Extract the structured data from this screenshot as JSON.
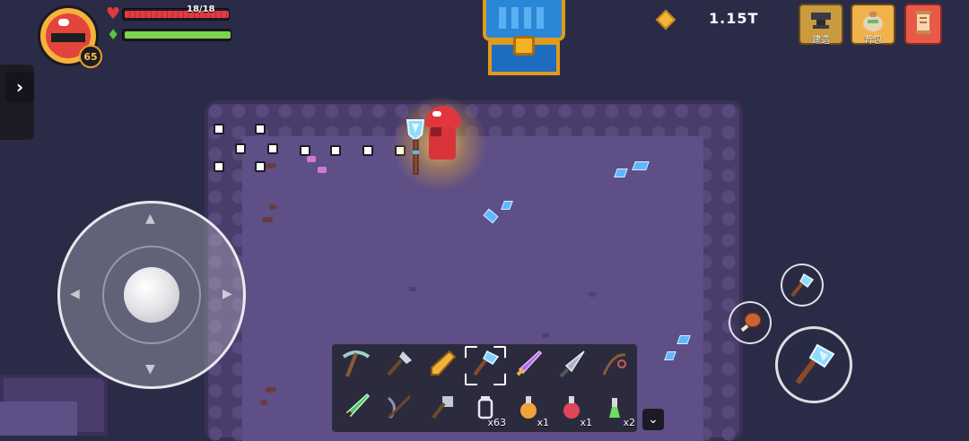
{
  "hud": {
    "player_level": "65",
    "hp": {
      "text": "18/18",
      "fraction": 1.0
    },
    "energy": {
      "fraction": 1.0
    },
    "coins": "1.15T"
  },
  "top_buttons": [
    {
      "id": "build",
      "label": "建造",
      "icon": "anvil-icon"
    },
    {
      "id": "bag",
      "label": "背包",
      "icon": "bag-icon"
    },
    {
      "id": "scroll",
      "label": "",
      "icon": "scroll-icon"
    }
  ],
  "hotbar": {
    "row1": [
      {
        "icon": "pickaxe-icon",
        "color": "#9bd3c6",
        "qty": ""
      },
      {
        "icon": "shovel-icon",
        "color": "#cfd6e3",
        "qty": ""
      },
      {
        "icon": "golden-club-icon",
        "color": "#f2b23a",
        "qty": ""
      },
      {
        "icon": "crystal-hammer-icon",
        "color": "#7fd0ff",
        "qty": "",
        "selected": true
      },
      {
        "icon": "purple-sword-icon",
        "color": "#b06ae0",
        "qty": ""
      },
      {
        "icon": "drill-icon",
        "color": "#aab4c6",
        "qty": ""
      },
      {
        "icon": "fishing-rod-icon",
        "color": "#d05a5a",
        "qty": ""
      }
    ],
    "row2": [
      {
        "icon": "green-sword-icon",
        "color": "#4cc463",
        "qty": ""
      },
      {
        "icon": "crossbow-icon",
        "color": "#8a93b5",
        "qty": ""
      },
      {
        "icon": "axe-icon",
        "color": "#c3c9d6",
        "qty": ""
      },
      {
        "icon": "jar-icon",
        "color": "#e8e8ee",
        "qty": "x63"
      },
      {
        "icon": "orange-potion-icon",
        "color": "#f2a23a",
        "qty": "x1"
      },
      {
        "icon": "red-potion-icon",
        "color": "#e2455a",
        "qty": "x1"
      },
      {
        "icon": "green-potion-icon",
        "color": "#6fdc63",
        "qty": "x2"
      }
    ]
  },
  "colors": {
    "background": "#2a2c47",
    "cave_floor": "#5e4f86",
    "hp": "#e23a43",
    "energy": "#7dd54c"
  }
}
